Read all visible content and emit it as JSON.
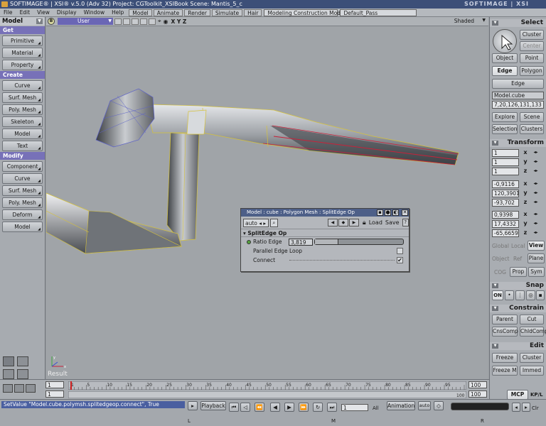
{
  "titlebar": {
    "text": "SOFTIMAGE® | XSI® v.5.0 (Adv 32) Project: CGToolkit_XSIBook    Scene: Mantis_5_c",
    "brand": "SOFTIMAGE | XSI"
  },
  "menubar": {
    "items": [
      "File",
      "Edit",
      "View",
      "Display",
      "Window",
      "Help"
    ],
    "modules": [
      "Model",
      "Animate",
      "Render",
      "Simulate",
      "Hair"
    ],
    "mode": "Modeling Construction Mode",
    "pass": "Default_Pass"
  },
  "left_toolbar": {
    "module": "Model",
    "sections": [
      {
        "title": "Get",
        "buttons": [
          "Primitive",
          "Material",
          "Property"
        ]
      },
      {
        "title": "Create",
        "buttons": [
          "Curve",
          "Surf. Mesh",
          "Poly. Mesh",
          "Skeleton",
          "Model",
          "Text"
        ]
      },
      {
        "title": "Modify",
        "buttons": [
          "Component",
          "Curve",
          "Surf. Mesh",
          "Poly. Mesh",
          "Deform",
          "Model"
        ]
      }
    ]
  },
  "viewport": {
    "letter": "B",
    "camera": "User",
    "axes": "X Y Z",
    "shading": "Shaded",
    "result_label": "Result"
  },
  "property_panel": {
    "title": "Model : cube : Polygon Mesh : SplitEdge Op",
    "auto": "auto",
    "load": "Load",
    "save": "Save",
    "help": "?",
    "section": "SplitEdge Op",
    "ratio_label": "Ratio Edge",
    "ratio_value": "3,819",
    "ratio_fraction": 0.27,
    "parallel_label": "Parallel Edge Loop",
    "parallel_checked": false,
    "connect_label": "Connect",
    "connect_checked": true
  },
  "right_panel": {
    "select_title": "Select",
    "cluster": "Cluster",
    "center": "Center",
    "object": "Object",
    "point": "Point",
    "edge": "Edge",
    "polygon": "Polygon",
    "edge2": "Edge",
    "object_name": "Model.cube",
    "selection_ids": "7,20,126,131,133",
    "explore": "Explore",
    "scene": "Scene",
    "selection": "Selection",
    "clusters": "Clusters",
    "transform_title": "Transform",
    "scale": [
      "1",
      "1",
      "1"
    ],
    "rotation": [
      "-0,9116",
      "120,3901",
      "-93,702"
    ],
    "translation": [
      "0,9398",
      "17,4332",
      "-65,6659"
    ],
    "axis_labels": [
      "x",
      "y",
      "z"
    ],
    "global": "Global",
    "local": "Local",
    "view": "View",
    "object_ref": "Object",
    "ref": "Ref",
    "plane": "Plane",
    "cog": "COG",
    "prop": "Prop",
    "sym": "Sym",
    "snap_title": "Snap",
    "snap_on": "ON",
    "constrain_title": "Constrain",
    "parent": "Parent",
    "cut": "Cut",
    "cnscomp": "CnsComp",
    "chldcomp": "ChldComp",
    "edit_title": "Edit",
    "freeze": "Freeze",
    "edit_cluster": "Cluster",
    "freeze_m": "Freeze M",
    "immed": "Immed",
    "mcp": "MCP",
    "kpl": "KP/L"
  },
  "timeline": {
    "start": "1",
    "end": "100",
    "start2": "1",
    "end2": "100",
    "current_end": "100",
    "ticks": [
      "1",
      "5",
      "10",
      "15",
      "20",
      "25",
      "30",
      "35",
      "40",
      "45",
      "50",
      "55",
      "60",
      "65",
      "70",
      "75",
      "80",
      "85",
      "90",
      "95"
    ],
    "ticks_bottom": [
      "100"
    ]
  },
  "status": {
    "command": "SetValue \"Model.cube.polymsh.splitedgeop.connect\", True",
    "playback": "Playback",
    "frame": "1",
    "all": "All",
    "animation": "Animation",
    "auto": "auto",
    "clr": "Clr",
    "labels": [
      "L",
      "M",
      "R"
    ]
  },
  "colors": {
    "accent_purple": "#7771b8",
    "title_blue": "#3c4f78",
    "selected_edge": "#c8223a",
    "mesh_edge": "#d6c23a"
  }
}
